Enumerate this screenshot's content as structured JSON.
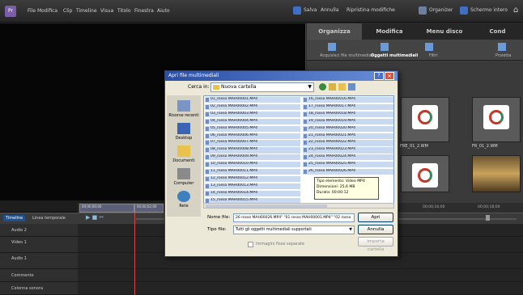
{
  "menubar": {
    "items": [
      "File",
      "Modifica",
      "Clip",
      "Timeline",
      "Visua",
      "Titolo",
      "Finestra",
      "Aiuto"
    ],
    "right_items": [
      "Salva",
      "Annulla",
      "Ripristina modifiche",
      "Organizer",
      "Schermo intero"
    ]
  },
  "right_panel": {
    "tabs": [
      "Organizza",
      "Modifica",
      "Menu disco",
      "Cond"
    ],
    "subtabs": [
      "Acquisisci file multimediali",
      "Oggetti multimediali",
      "Filtri",
      "Proietta"
    ],
    "thumbnails": [
      {
        "label": "FRE_01_2.WM"
      },
      {
        "label": "FR_01_2.WM"
      }
    ]
  },
  "timeline": {
    "toolbar": [
      "Timeline",
      "Linea temporale"
    ],
    "ruler": [
      "00;00;00;00",
      "00;00;02;00",
      "00;00;14;00",
      "00;00;16;00",
      "00;00;18;00"
    ],
    "tracks": [
      "Audio 2",
      "Video 1",
      "Audio 1",
      "Commento",
      "Colonna sonora"
    ]
  },
  "dialog": {
    "title": "Apri file multimediali",
    "lookin_label": "Cerca in:",
    "lookin_value": "Nuova cartella",
    "places": [
      "Risorse recenti",
      "Desktop",
      "Documenti",
      "Computer",
      "Rete"
    ],
    "files_col1": [
      "01_rosso MAH00001.MP4",
      "02_rosso MAH00002.MP4",
      "03_rosso MAH00003.MP4",
      "04_rosso MAH00004.MP4",
      "05_rosso MAH00005.MP4",
      "06_rosso MAH00006.MP4",
      "07_rossa MAH00007.MP4",
      "08_rosso MAH00008.MP4",
      "09_rosso MAH00009.MP4",
      "10_rosso MAH00010.MP4",
      "11_rosso MAH00011.MP4",
      "12_rosso MAH00012.MP4",
      "13_rosso MAH00013.MP4",
      "14_rosso MAH00014.MP4",
      "15_rosso MAH00015.MP4"
    ],
    "files_col2": [
      "16_rosso MAH00016.MP4",
      "17_rosso MAH00017.MP4",
      "18_rosso MAH00018.MP4",
      "19_rosso MAH00019.MP4",
      "20_rosso MAH00020.MP4",
      "21_rosso MAH00021.MP4",
      "22_rosso MAH00022.MP4",
      "23_rosso MAH00023.MP4",
      "24_rosso MAH00024.MP4",
      "25_rosso MAH00025.MP4",
      "26_rosso MAH00026.MP4"
    ],
    "tooltip": [
      "Tipo elemento: Video MP4",
      "Dimensioni: 25,6 MB",
      "Durata: 00:00:12"
    ],
    "filename_label": "Nome file:",
    "filename_value": "26 rosso MAH00026.MP4\" \"01 rosso MAH00001.MP4\" \"02 rosso",
    "filetype_label": "Tipo file:",
    "filetype_value": "Tutti gli oggetti multimediali supportati",
    "open_button": "Apri",
    "cancel_button": "Annulla",
    "import_button": "Importa cartella",
    "checkbox_label": "Immagini fisse separate"
  }
}
